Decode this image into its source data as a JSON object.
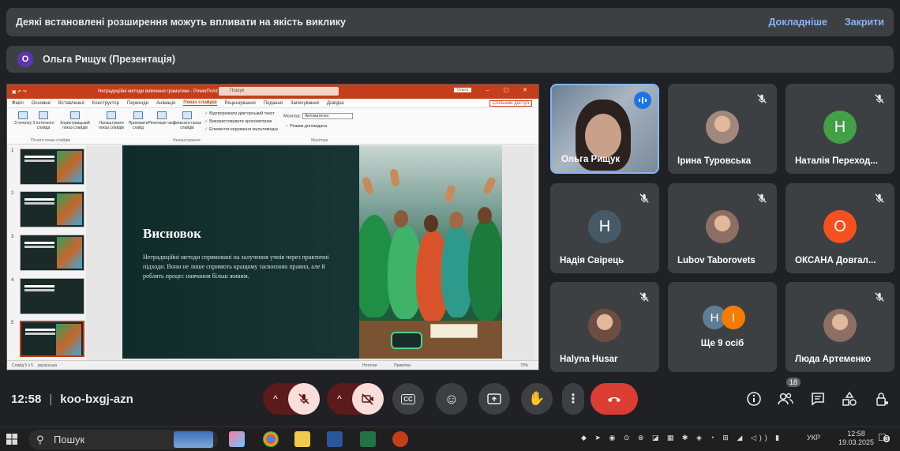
{
  "banner": {
    "message": "Деякі встановлені розширення можуть впливати на якість виклику",
    "learn_more": "Докладніше",
    "close": "Закрити"
  },
  "presenter": {
    "initial": "О",
    "label": "Ольга Рищук (Презентація)"
  },
  "powerpoint": {
    "doc_title": "Нетрадиційні методи вивчення граматики  -  PowerPoint",
    "search_placeholder": "Пошук",
    "user_chip": "Ольга",
    "menu": [
      "Файл",
      "Основне",
      "Вставлення",
      "Конструктор",
      "Переходи",
      "Анімація",
      "Показ слайдів",
      "Рецензування",
      "Подання",
      "Записування",
      "Довідка"
    ],
    "active_menu": "Показ слайдів",
    "share_label": "Спільний доступ",
    "ribbon": {
      "buttons": [
        "З початку",
        "З поточного слайда",
        "Користувацький показ слайдів",
        "Налаштувати показ слайдів",
        "Приховати слайд",
        "Репетиція часу",
        "Записати показ слайдів"
      ],
      "checks": [
        "Відтворювати дикторський текст",
        "Використовувати хронометраж",
        "Елементи керування мультимедіа"
      ],
      "monitor_label": "Монітор:",
      "monitor_value": "Автоматично",
      "presenter_view": "Режим доповідача",
      "groups": [
        "Почати показ слайдів",
        "Налаштування",
        "Монітори"
      ]
    },
    "slide": {
      "title": "Висновок",
      "body": "Нетрадиційні методи спрямовані на залучення учнів через практичні підходи. Вони не лише сприяють кращому засвоєнню правил, але й роблять процес навчання більш живим."
    },
    "thumbnails": [
      "1",
      "2",
      "3",
      "4",
      "5"
    ],
    "status_left": "Слайд 5 з 5",
    "status_lang": "українська",
    "status_notes": "Нотатки",
    "status_comments": "Примітки",
    "zoom": "70%"
  },
  "participants": [
    {
      "name": "Ольга Рищук",
      "type": "camera",
      "speaking": true
    },
    {
      "name": "Ірина Туровська",
      "type": "photo",
      "muted": true
    },
    {
      "name": "Наталія Переходько",
      "display": "Наталія Переход...",
      "type": "letter",
      "initial": "Н",
      "color": "#43a047",
      "muted": true
    },
    {
      "name": "Надія Свірець",
      "type": "letter",
      "initial": "Н",
      "color": "#455a64",
      "muted": true
    },
    {
      "name": "Lubov Taborovets",
      "type": "photo",
      "muted": true
    },
    {
      "name": "ОКСАНА Довгал...",
      "type": "letter",
      "initial": "О",
      "color": "#f4511e",
      "muted": true
    },
    {
      "name": "Halyna Husar",
      "type": "photo",
      "muted": true
    },
    {
      "name": "Ще 9 осіб",
      "type": "more",
      "initials": [
        "Н",
        "І"
      ],
      "colors": [
        "#5f7d95",
        "#f57c00"
      ]
    },
    {
      "name": "Люда Артеменко",
      "type": "photo",
      "muted": true
    }
  ],
  "controls": {
    "time": "12:58",
    "meeting_code": "koo-bxgj-azn",
    "people_count": "18"
  },
  "taskbar": {
    "search": "Пошук",
    "lang": "УКР",
    "time": "12:58",
    "date": "19.03.2025",
    "notifications": "3"
  }
}
